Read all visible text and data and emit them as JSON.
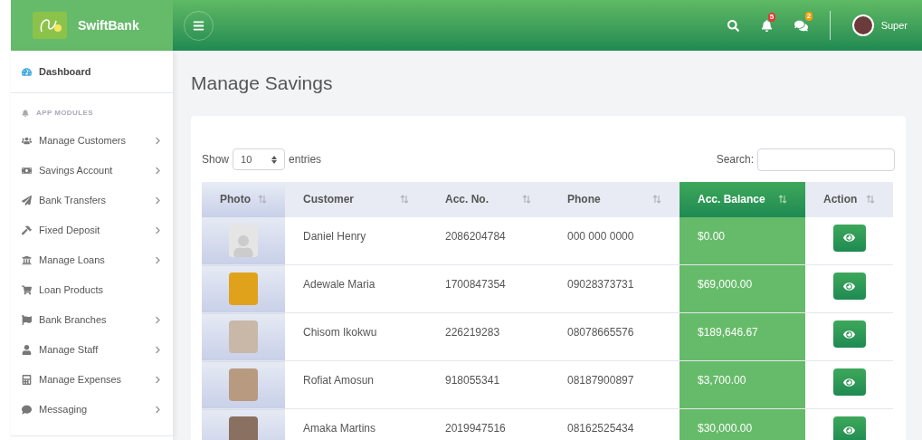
{
  "brand": {
    "name": "SwiftBank"
  },
  "topbar": {
    "notifications": "5",
    "messages": "2",
    "user": "Super"
  },
  "sidebar": {
    "dashboard": "Dashboard",
    "section": "APP MODULES",
    "items": [
      {
        "label": "Manage Customers",
        "chevron": true
      },
      {
        "label": "Savings Account",
        "chevron": true
      },
      {
        "label": "Bank Transfers",
        "chevron": true
      },
      {
        "label": "Fixed Deposit",
        "chevron": true
      },
      {
        "label": "Manage Loans",
        "chevron": true
      },
      {
        "label": "Loan Products",
        "chevron": false
      },
      {
        "label": "Bank Branches",
        "chevron": true
      },
      {
        "label": "Manage Staff",
        "chevron": true
      },
      {
        "label": "Manage Expenses",
        "chevron": true
      },
      {
        "label": "Messaging",
        "chevron": true
      }
    ]
  },
  "page": {
    "title": "Manage Savings"
  },
  "table": {
    "show_label": "Show",
    "page_size": "10",
    "entries_label": "entries",
    "search_label": "Search:",
    "columns": [
      {
        "label": "Photo",
        "selected": false
      },
      {
        "label": "Customer",
        "selected": false
      },
      {
        "label": "Acc. No.",
        "selected": false
      },
      {
        "label": "Phone",
        "selected": false
      },
      {
        "label": "Acc. Balance",
        "selected": true
      },
      {
        "label": "Action",
        "selected": false
      }
    ],
    "rows": [
      {
        "kind": "silhouette",
        "customer": "Daniel Henry",
        "acc_no": "2086204784",
        "phone": "000 000 0000",
        "balance": "$0.00"
      },
      {
        "kind": "photo",
        "customer": "Adewale Maria",
        "acc_no": "1700847354",
        "phone": "09028373731",
        "balance": "$69,000.00"
      },
      {
        "kind": "photo",
        "customer": "Chisom Ikokwu",
        "acc_no": "226219283",
        "phone": "08078665576",
        "balance": "$189,646.67"
      },
      {
        "kind": "photo",
        "customer": "Rofiat Amosun",
        "acc_no": "918055341",
        "phone": "08187900897",
        "balance": "$3,700.00"
      },
      {
        "kind": "photo",
        "customer": "Amaka Martins",
        "acc_no": "2019947516",
        "phone": "08162525434",
        "balance": "$30,000.00"
      }
    ]
  }
}
